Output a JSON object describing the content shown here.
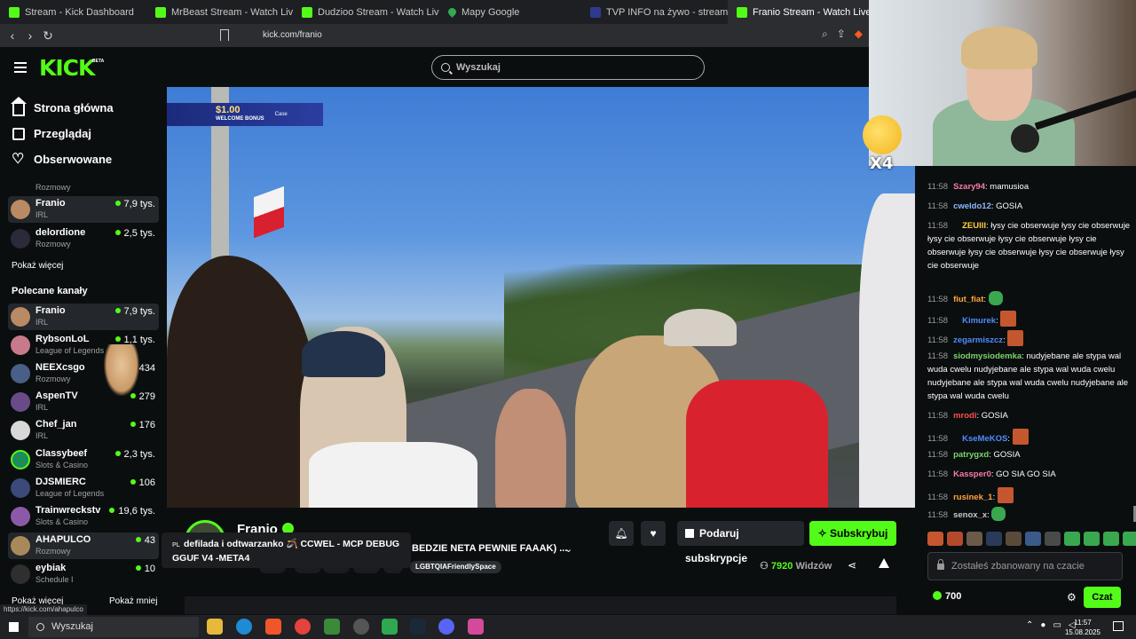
{
  "browser": {
    "tabs": [
      {
        "label": "Stream - Kick Dashboard"
      },
      {
        "label": "MrBeast Stream - Watch Live on K"
      },
      {
        "label": "Dudzioo Stream - Watch Live on Kick"
      },
      {
        "label": "Mapy Google"
      },
      {
        "label": "TVP INFO na żywo - stream, live,"
      },
      {
        "label": "Franio Stream - Watch Live o"
      }
    ],
    "url": "kick.com/franio"
  },
  "header": {
    "logo": "KICK",
    "beta": "BETA",
    "search_placeholder": "Wyszukaj"
  },
  "nav": {
    "home": "Strona główna",
    "browse": "Przeglądaj",
    "following": "Obserwowane"
  },
  "following": {
    "partial_category": "Rozmowy",
    "channels": [
      {
        "name": "Franio",
        "category": "IRL",
        "viewers": "7,9 tys."
      },
      {
        "name": "delordione",
        "category": "Rozmowy",
        "viewers": "2,5 tys."
      }
    ],
    "show_more": "Pokaż więcej"
  },
  "recommended": {
    "heading": "Polecane kanały",
    "channels": [
      {
        "name": "Franio",
        "category": "IRL",
        "viewers": "7,9 tys."
      },
      {
        "name": "RybsonLoL",
        "category": "League of Legends",
        "viewers": "1,1 tys."
      },
      {
        "name": "NEEXcsgo",
        "category": "Rozmowy",
        "viewers": "434"
      },
      {
        "name": "AspenTV",
        "category": "IRL",
        "viewers": "279"
      },
      {
        "name": "Chef_jan",
        "category": "IRL",
        "viewers": "176"
      },
      {
        "name": "Classybeef",
        "category": "Slots & Casino",
        "viewers": "2,3 tys."
      },
      {
        "name": "DJSMIERC",
        "category": "League of Legends",
        "viewers": "106"
      },
      {
        "name": "Trainwreckstv",
        "category": "Slots & Casino",
        "viewers": "19,6 tys."
      },
      {
        "name": "AHAPULCO",
        "category": "Rozmowy",
        "viewers": "43"
      },
      {
        "name": "eybiak",
        "category": "Schedule I",
        "viewers": "10"
      }
    ],
    "show_more": "Pokaż więcej",
    "show_less": "Pokaż mniej"
  },
  "video": {
    "banner_amount": "$1.00",
    "banner_text": "WELCOME BONUS",
    "banner_brand": "Case"
  },
  "overlay": {
    "multiplier": "X4"
  },
  "stream": {
    "streamer": "Franio",
    "title_fragment": "BEDZIE NETA PEWNIE FAAAK) ...",
    "tag": "LGBTQIAFriendlySpace",
    "gift_label": "Podaruj subskrypcje",
    "subscribe_label": "Subskrybuj",
    "viewer_count": "7920",
    "viewers_label": "Widzów"
  },
  "tooltip": {
    "lang": "PL",
    "text": "defilada i odtwarzanko 🪃 CCWEL - MCP DEBUG GGUF V4 -META4"
  },
  "status_url": "https://kick.com/ahapulco",
  "chat": {
    "messages": [
      {
        "time": "11:58",
        "user": "Szary94",
        "color": "#f87ca4",
        "text": "mamusioa"
      },
      {
        "time": "11:58",
        "user": "cweldo12",
        "color": "#8fb6ff",
        "text": "GOSIA"
      },
      {
        "time": "11:58",
        "user": "ZEUlll",
        "color": "#ffd23f",
        "text": "łysy cie obserwuje łysy cie obserwuje łysy cie obserwuje łysy cie obserwuje łysy cie obserwuje łysy cie obserwuje łysy cie obserwuje łysy cie obserwuje"
      },
      {
        "time": "11:58",
        "user": "fiut_fiat",
        "color": "#ffa43a",
        "text": ""
      },
      {
        "time": "11:58",
        "user": "Kimurek",
        "color": "#4d8cff",
        "text": ""
      },
      {
        "time": "11:58",
        "user": "zegarmiszcz",
        "color": "#4d8cff",
        "text": ""
      },
      {
        "time": "11:58",
        "user": "siodmysiodemka",
        "color": "#7bd66b",
        "text": "nudyjebane ale stypa wal wuda cwelu nudyjebane ale stypa wal wuda cwelu nudyjebane ale stypa wal wuda cwelu nudyjebane ale stypa wal wuda cwelu"
      },
      {
        "time": "11:58",
        "user": "mrodi",
        "color": "#ff4d4d",
        "text": "GOSIA"
      },
      {
        "time": "11:58",
        "user": "KseMeKOS",
        "color": "#4d8cff",
        "text": ""
      },
      {
        "time": "11:58",
        "user": "patrygxd",
        "color": "#7bd66b",
        "text": "GOSIA"
      },
      {
        "time": "11:58",
        "user": "Kassper0",
        "color": "#f87ca4",
        "text": "GO SIA GO SIA"
      },
      {
        "time": "11:58",
        "user": "rusinek_1",
        "color": "#ffa43a",
        "text": ""
      },
      {
        "time": "11:58",
        "user": "senox_x",
        "color": "#c9c9c9",
        "text": ""
      }
    ],
    "input_placeholder": "Zostałeś zbanowany na czacie",
    "points": "700",
    "chat_button": "Czat"
  },
  "taskbar": {
    "search": "Wyszukaj",
    "time": "11:57",
    "date": "15.08.2025"
  },
  "colors": {
    "accent": "#53fc18",
    "bg": "#0b0e0f"
  }
}
